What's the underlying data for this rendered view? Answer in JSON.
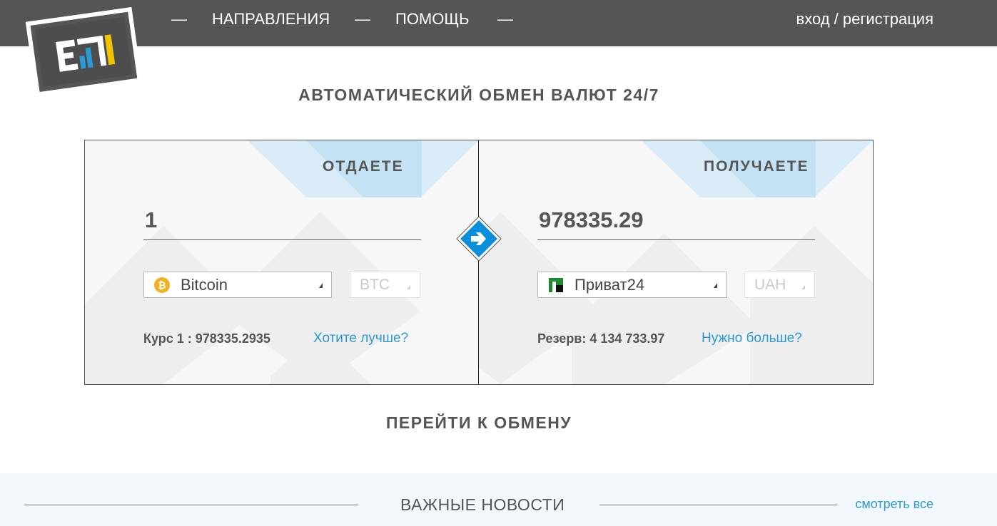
{
  "header": {
    "nav": [
      {
        "label": "НАПРАВЛЕНИЯ"
      },
      {
        "label": "ПОМОЩЬ"
      }
    ],
    "separator": "—",
    "login_label": "вход / регистрация"
  },
  "headline": "АВТОМАТИЧЕСКИЙ ОБМЕН ВАЛЮТ 24/7",
  "give": {
    "title": "ОТДАЕТЕ",
    "amount": "1",
    "system": "Bitcoin",
    "system_icon": "bitcoin-icon",
    "currency": "BTC",
    "rate_text": "Курс 1 : 978335.2935",
    "link": "Хотите лучше?"
  },
  "receive": {
    "title": "ПОЛУЧАЕТЕ",
    "amount": "978335.29",
    "system": "Приват24",
    "system_icon": "privat24-icon",
    "currency": "UAH",
    "reserve_text": "Резерв: 4 134 733.97",
    "link": "Нужно больше?"
  },
  "cta": "ПЕРЕЙТИ К ОБМЕНУ",
  "news": {
    "title": "ВАЖНЫЕ НОВОСТИ",
    "view_all": "смотреть все"
  },
  "colors": {
    "header_bg": "#555555",
    "accent": "#2a9ad6",
    "arrow": "#0a8fdc",
    "panel_bg": "#f7f7f7",
    "news_bg": "#f2f8fb"
  }
}
